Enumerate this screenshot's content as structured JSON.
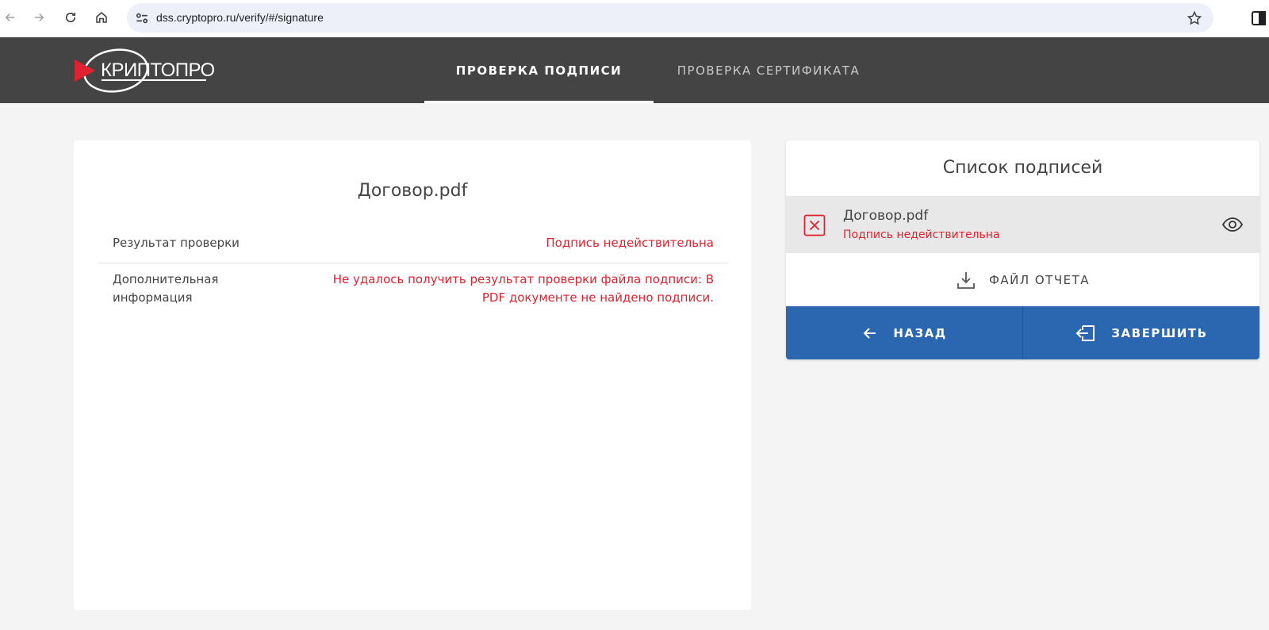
{
  "browser": {
    "url": "dss.cryptopro.ru/verify/#/signature"
  },
  "header": {
    "logo_text": "КРИПТОПРО",
    "tabs": [
      {
        "label": "ПРОВЕРКА ПОДПИСИ",
        "active": true
      },
      {
        "label": "ПРОВЕРКА СЕРТИФИКАТА",
        "active": false
      }
    ]
  },
  "document": {
    "title": "Договор.pdf",
    "rows": [
      {
        "label": "Результат проверки",
        "value": "Подпись недействительна"
      },
      {
        "label": "Дополнительная информация",
        "value": "Не удалось получить результат проверки файла подписи: В PDF документе не найдено подписи."
      }
    ]
  },
  "signatures": {
    "title": "Список подписей",
    "items": [
      {
        "name": "Договор.pdf",
        "status": "Подпись недействительна"
      }
    ],
    "report_label": "ФАЙЛ ОТЧЕТА",
    "back_label": "НАЗАД",
    "finish_label": "ЗАВЕРШИТЬ"
  },
  "colors": {
    "accent_blue": "#2a67b0",
    "error_red": "#e0212f",
    "header_bg": "#444444"
  }
}
